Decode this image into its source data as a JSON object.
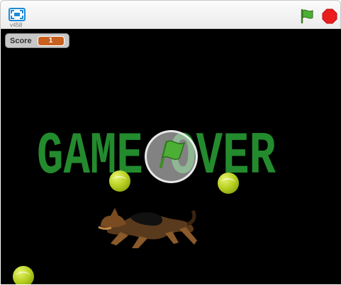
{
  "toolbar": {
    "version": "v458",
    "fullscreen_icon": "fullscreen-icon",
    "green_flag_icon": "green-flag-icon",
    "stop_icon": "stop-icon"
  },
  "stage": {
    "score_label": "Score",
    "score_value": "1",
    "gameover_text": "GAME OVER",
    "sprites": [
      "tennis-ball",
      "tennis-ball",
      "tennis-ball",
      "german-shepherd-dog"
    ]
  }
}
